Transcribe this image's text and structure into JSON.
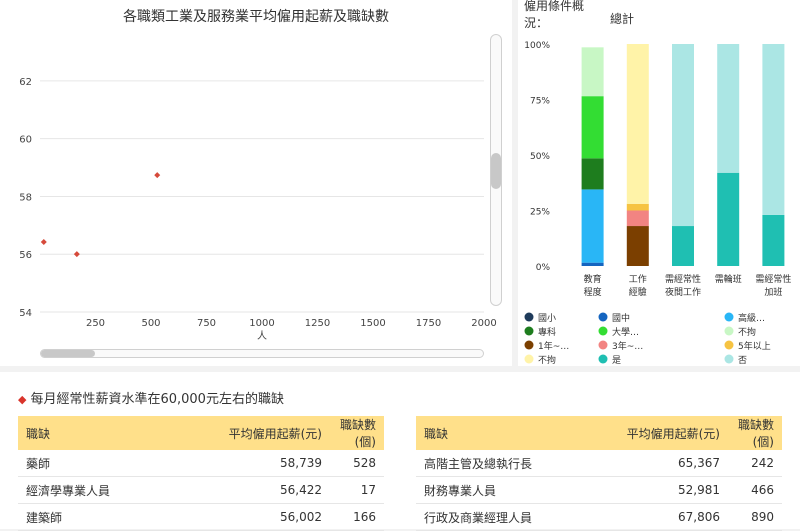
{
  "left_chart": {
    "title": "各職類工業及服務業平均僱用起薪及職缺數",
    "xlabel": "人"
  },
  "right_chart": {
    "header_label": "僱用條件概況：",
    "subtitle": "總計"
  },
  "bottom": {
    "section_title": "每月經常性薪資水準在60,000元左右的職缺",
    "table_headers": [
      "職缺",
      "平均僱用起薪(元)",
      "職缺數(個)"
    ],
    "left_rows": [
      [
        "藥師",
        "58,739",
        "528"
      ],
      [
        "經濟學專業人員",
        "56,422",
        "17"
      ],
      [
        "建築師",
        "56,002",
        "166"
      ]
    ],
    "right_rows": [
      [
        "高階主管及總執行長",
        "65,367",
        "242"
      ],
      [
        "財務專業人員",
        "52,981",
        "466"
      ],
      [
        "行政及商業經理人員",
        "67,806",
        "890"
      ]
    ]
  },
  "chart_data": [
    {
      "type": "scatter",
      "title": "各職類工業及服務業平均僱用起薪及職缺數",
      "xlabel": "人",
      "ylabel": "",
      "xlim": [
        0,
        2000
      ],
      "ylim": [
        54,
        63
      ],
      "xticks": [
        250,
        500,
        750,
        1000,
        1250,
        1500,
        1750,
        2000
      ],
      "yticks": [
        54,
        56,
        58,
        60,
        62
      ],
      "grid": true,
      "marker_color": "#d64a3b",
      "points": [
        {
          "x": 528,
          "y": 58.739
        },
        {
          "x": 17,
          "y": 56.422
        },
        {
          "x": 166,
          "y": 56.002
        }
      ]
    },
    {
      "type": "bar",
      "stacked": true,
      "title": "總計",
      "categories": [
        "教育程度",
        "工作經驗",
        "需經常性夜間工作",
        "需輪班",
        "需經常性加班"
      ],
      "category_lines": [
        [
          "教育",
          "程度"
        ],
        [
          "工作",
          "經驗"
        ],
        [
          "需經常性",
          "夜間工作"
        ],
        [
          "需輪班"
        ],
        [
          "需經常性",
          "加班"
        ]
      ],
      "yticks": [
        "0%",
        "25%",
        "50%",
        "75%",
        "100%"
      ],
      "ylim": [
        0,
        100
      ],
      "legend_position": "bottom",
      "series": [
        {
          "name": "國小",
          "color": "#1f3b5b",
          "values": [
            0,
            0,
            0,
            0,
            0
          ]
        },
        {
          "name": "國中",
          "color": "#1565c0",
          "values": [
            1.5,
            0,
            0,
            0,
            0
          ]
        },
        {
          "name": "高級…",
          "color": "#29b6f6",
          "values": [
            33,
            0,
            0,
            0,
            0
          ]
        },
        {
          "name": "專科",
          "color": "#1e7d1e",
          "values": [
            14,
            0,
            0,
            0,
            0
          ]
        },
        {
          "name": "大學…",
          "color": "#33dd33",
          "values": [
            28,
            0,
            0,
            0,
            0
          ]
        },
        {
          "name": "不拘",
          "color": "#c8f7c5",
          "values": [
            22,
            0,
            0,
            0,
            0
          ]
        },
        {
          "name": "1年~…",
          "color": "#7b3f00",
          "values": [
            0,
            18,
            0,
            0,
            0
          ]
        },
        {
          "name": "3年~…",
          "color": "#f28482",
          "values": [
            0,
            7,
            0,
            0,
            0
          ]
        },
        {
          "name": "5年以上",
          "color": "#f6c342",
          "values": [
            0,
            3,
            0,
            0,
            0
          ]
        },
        {
          "name": "不拘",
          "color": "#fff3a8",
          "values": [
            0,
            72,
            0,
            0,
            0
          ]
        },
        {
          "name": "是",
          "color": "#1fbfb2",
          "values": [
            0,
            0,
            18,
            42,
            23
          ]
        },
        {
          "name": "否",
          "color": "#abe6e4",
          "values": [
            0,
            0,
            82,
            58,
            77
          ]
        }
      ]
    }
  ]
}
